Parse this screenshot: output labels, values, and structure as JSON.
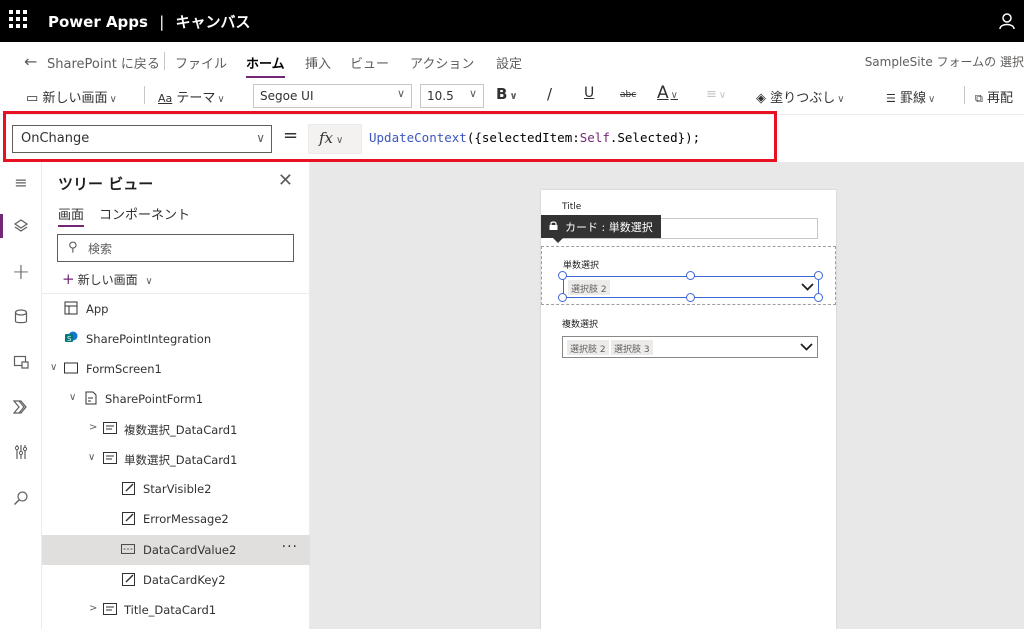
{
  "titlebar": {
    "app_name": "Power Apps",
    "separator": "|",
    "app_type": "キャンバス"
  },
  "menubar": {
    "back_label": "SharePoint に戻る",
    "items": [
      "ファイル",
      "ホーム",
      "挿入",
      "ビュー",
      "アクション",
      "設定"
    ],
    "active_item": "ホーム",
    "right_text": "SampleSite フォームの 選択"
  },
  "ribbon": {
    "new_screen": "新しい画面",
    "theme": "テーマ",
    "font": "Segoe UI",
    "font_size": "10.5",
    "bold": "B",
    "italic": "/",
    "underline": "U",
    "strike": "abc",
    "font_color": "A",
    "fill": "塗りつぶし",
    "border": "罫線",
    "reorder": "再配"
  },
  "formulabar": {
    "property": "OnChange",
    "equals": "=",
    "fx": "fx",
    "formula": {
      "fn": "UpdateContext",
      "open": "({",
      "key": "selectedItem:",
      "self": "Self",
      "rest": ".Selected});"
    }
  },
  "tree": {
    "title": "ツリー ビュー",
    "tabs": [
      "画面",
      "コンポーネント"
    ],
    "search_placeholder": "検索",
    "new_screen": "新しい画面",
    "nodes": [
      {
        "label": "App"
      },
      {
        "label": "SharePointIntegration"
      },
      {
        "label": "FormScreen1"
      },
      {
        "label": "SharePointForm1"
      },
      {
        "label": "複数選択_DataCard1"
      },
      {
        "label": "単数選択_DataCard1"
      },
      {
        "label": "StarVisible2"
      },
      {
        "label": "ErrorMessage2"
      },
      {
        "label": "DataCardValue2",
        "more": "···"
      },
      {
        "label": "DataCardKey2"
      },
      {
        "label": "Title_DataCard1"
      }
    ]
  },
  "form": {
    "title_label": "Title",
    "tooltip": "カード : 単数選択",
    "single_label": "単数選択",
    "single_value": "選択肢 2",
    "multi_label": "複数選択",
    "multi_values": [
      "選択肢 2",
      "選択肢 3"
    ]
  },
  "colors": {
    "accent": "#742774",
    "highlight": "#e81123",
    "selection": "#3c66d6"
  }
}
